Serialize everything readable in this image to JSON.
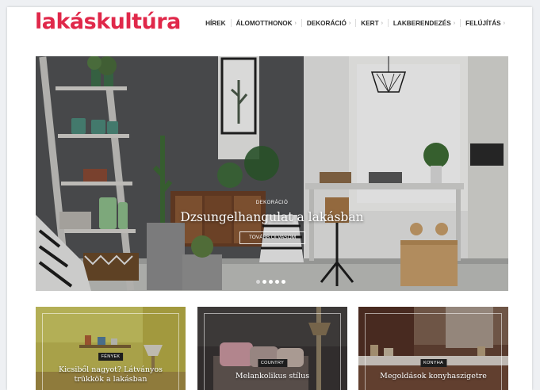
{
  "brand": {
    "name": "lakáskultúra",
    "color": "#e0284a"
  },
  "nav": {
    "items": [
      {
        "label": "Hírek",
        "has_dropdown": false
      },
      {
        "label": "Álomotthonok",
        "has_dropdown": true
      },
      {
        "label": "Dekoráció",
        "has_dropdown": true
      },
      {
        "label": "Kert",
        "has_dropdown": true
      },
      {
        "label": "Lakberendezés",
        "has_dropdown": true
      },
      {
        "label": "Felújítás",
        "has_dropdown": true
      }
    ],
    "dropdown_icon": "chevron-right-icon"
  },
  "hero": {
    "category": "DEKORÁCIÓ",
    "title": "Dzsungelhangulat a lakásban",
    "button_label": "TOVÁBB OLVASOM",
    "slides": {
      "count": 5,
      "active_index": 0
    }
  },
  "cards": [
    {
      "category": "FÉNYEK",
      "title": "Kicsiből nagyot? Látványos trükkök a lakásban"
    },
    {
      "category": "COUNTRY",
      "title": "Melankolikus stílus"
    },
    {
      "category": "KONYHA",
      "title": "Megoldások konyhaszigetre"
    }
  ]
}
